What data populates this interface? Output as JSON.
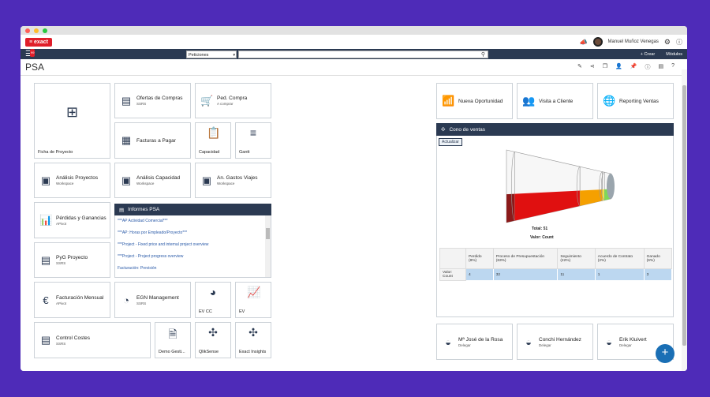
{
  "app": {
    "logo": "≡ exact",
    "user": "Manuel Muñoz Venegas"
  },
  "nav": {
    "badge": "99",
    "search_scope": "Peticiones",
    "create": "+ Crear",
    "modules": "Módulos"
  },
  "page": {
    "title": "PSA"
  },
  "tiles": {
    "ficha": {
      "label": "Ficha de Proyecto",
      "icon": "org-chart-icon"
    },
    "ofertas": {
      "label": "Ofertas de Compras",
      "sub": "SSRS"
    },
    "pedcompra": {
      "label": "Ped. Compra",
      "sub": "A comprar"
    },
    "facturas": {
      "label": "Facturas a Pagar"
    },
    "capacidad": {
      "label": "Capacidad"
    },
    "gantt": {
      "label": "Gantt"
    },
    "analisis_proy": {
      "label": "Análisis Proyectos",
      "sub": "Workspace"
    },
    "analisis_cap": {
      "label": "Análisis Capacidad",
      "sub": "Workspace"
    },
    "gastos": {
      "label": "An. Gastos Viajes",
      "sub": "Workspace"
    },
    "pyg": {
      "label": "Pérdidas y Ganancias",
      "sub": "APivot"
    },
    "pygproy": {
      "label": "PyG Proyecto",
      "sub": "SSRS"
    },
    "facmensual": {
      "label": "Facturación Mensual",
      "sub": "APivot"
    },
    "egn": {
      "label": "EGN Management",
      "sub": "SSRS"
    },
    "evcc": {
      "label": "EV CC"
    },
    "ev": {
      "label": "EV"
    },
    "control": {
      "label": "Control Costes",
      "sub": "SSRS"
    },
    "demo": {
      "label": "Demo Gesti..."
    },
    "qlik": {
      "label": "QlikSense"
    },
    "insights": {
      "label": "Exact Insights"
    },
    "nueva": {
      "label": "Nueva Oportunidad"
    },
    "visita": {
      "label": "Visita a Cliente"
    },
    "reporting": {
      "label": "Reporting Ventas"
    },
    "p1": {
      "label": "Mª José de la Rosa",
      "sub": "Delegar"
    },
    "p2": {
      "label": "Conchi Hernández",
      "sub": "Delegar"
    },
    "p3": {
      "label": "Erik Kluivert",
      "sub": "Delegar"
    }
  },
  "informes": {
    "title": "Informes PSA",
    "links": [
      "***AP Actividad Comercial***",
      "***AP: Horas por Empleado/Proyecto***",
      "***Project - Fixed price and internal project overview",
      "***Project - Project progress overview",
      "Facturación: Previsión"
    ]
  },
  "cono": {
    "title": "Cono de ventas",
    "refresh": "Actualizar",
    "total": "Total: 51",
    "value_label": "Valor: Count",
    "headers": [
      "",
      "Perdido (8%)",
      "Proceso de Presupuestación (63%)",
      "Seguimiento (22%)",
      "Acuerdo de Contrato (2%)",
      "Ganado (6%)"
    ],
    "row_label": "Valor: Count",
    "values": [
      "4",
      "32",
      "11",
      "1",
      "3"
    ]
  },
  "chart_data": {
    "type": "funnel",
    "categories": [
      "Perdido",
      "Proceso de Presupuestación",
      "Seguimiento",
      "Acuerdo de Contrato",
      "Ganado"
    ],
    "values": [
      4,
      32,
      11,
      1,
      3
    ],
    "colors": [
      "#8b1a1a",
      "#e01010",
      "#f5a000",
      "#f2e44a",
      "#7ed957"
    ]
  }
}
